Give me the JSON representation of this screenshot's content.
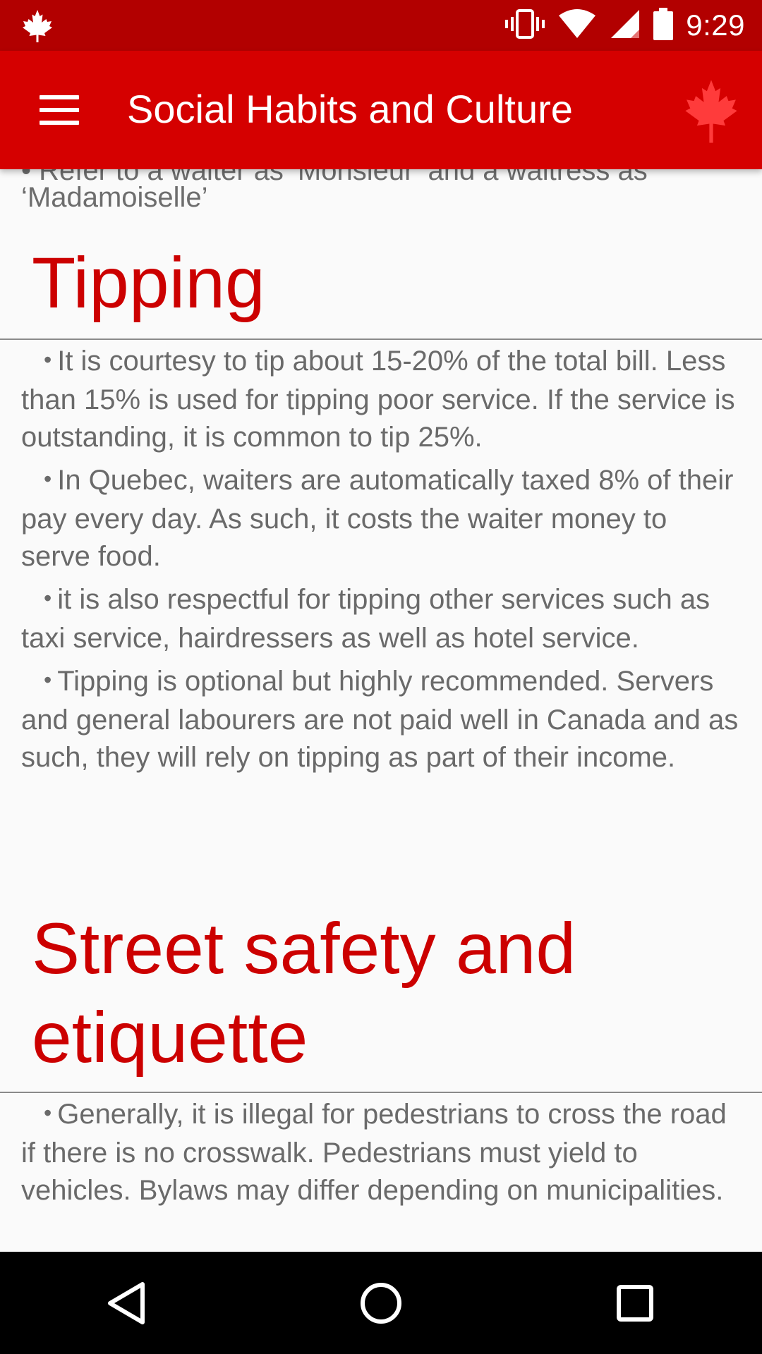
{
  "status_bar": {
    "time": "9:29",
    "icons": [
      "maple-leaf-icon",
      "vibrate-icon",
      "wifi-icon",
      "cell-signal-icon",
      "battery-icon"
    ]
  },
  "app_bar": {
    "title": "Social Habits and Culture",
    "menu_icon": "hamburger-menu-icon",
    "logo_icon": "maple-leaf-icon"
  },
  "content": {
    "cut_off_line": "• Refer to a waiter as ‘Monsieur’ and a waitress as",
    "cut_off_continuation": "‘Madamoiselle’",
    "sections": [
      {
        "title": "Tipping",
        "bullets": [
          "It is courtesy to tip about 15-20% of the total bill. Less than 15% is used for tipping poor service. If the service is outstanding, it is common to tip 25%.",
          "In Quebec, waiters are automatically taxed 8% of their pay every day. As such, it costs the waiter money to serve food.",
          "it is also respectful for tipping other services such as taxi service, hairdressers as well as hotel service.",
          "Tipping is optional but highly recommended. Servers and general labourers are not paid well in Canada and as such, they will rely on tipping as part of their income."
        ]
      },
      {
        "title": "Street safety and etiquette",
        "bullets": [
          "Generally, it is illegal for pedestrians to cross the road if there is no crosswalk. Pedestrians must yield to vehicles. Bylaws may differ depending on municipalities."
        ]
      }
    ]
  },
  "nav_bar": {
    "buttons": [
      "back-icon",
      "home-icon",
      "recents-icon"
    ]
  },
  "colors": {
    "status_bar": "#b20000",
    "app_bar": "#d50000",
    "heading": "#cc0000",
    "body_text": "#6a6a6a",
    "background": "#fafafa"
  }
}
